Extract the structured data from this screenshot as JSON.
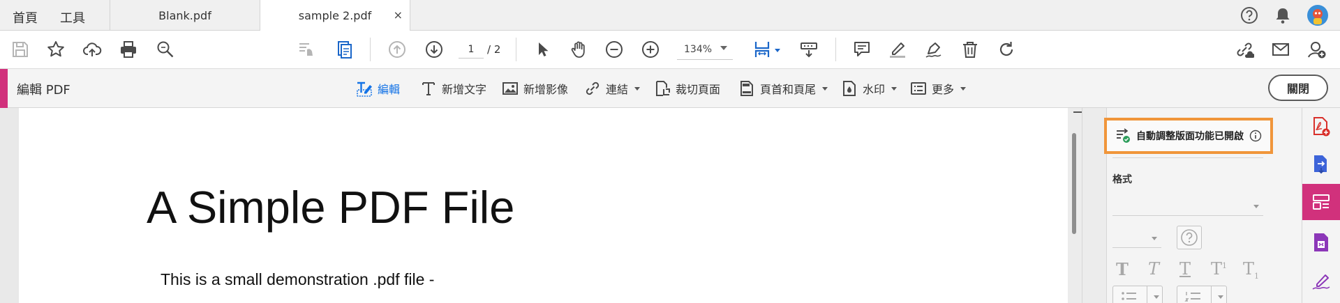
{
  "tabs": {
    "home_label": "首頁",
    "tools_label": "工具",
    "documents": [
      {
        "label": "Blank.pdf",
        "active": false
      },
      {
        "label": "sample 2.pdf",
        "active": true
      }
    ],
    "close_glyph": "×"
  },
  "header_icons": [
    "help-icon",
    "bell-icon",
    "avatar"
  ],
  "toolbar": {
    "page_current": "1",
    "page_total": "/ 2",
    "zoom": "134%",
    "icons": [
      "save-icon",
      "star-icon",
      "cloud-upload-icon",
      "print-icon",
      "zoom-search-icon",
      "read-mode-icon",
      "page-icon",
      "page-up-icon",
      "page-down-icon",
      "select-arrow-icon",
      "hand-icon",
      "zoom-out-icon",
      "zoom-in-icon",
      "fit-page-icon",
      "scroll-mode-icon",
      "comment-icon",
      "highlight-icon",
      "sign-icon",
      "delete-icon",
      "rotate-icon",
      "share-link-icon",
      "email-icon",
      "add-user-icon"
    ]
  },
  "edit_bar": {
    "title": "編輯 PDF",
    "tools": [
      {
        "label": "編輯",
        "icon": "edit-text-icon",
        "active": true,
        "dropdown": false
      },
      {
        "label": "新增文字",
        "icon": "add-text-icon",
        "active": false,
        "dropdown": false
      },
      {
        "label": "新增影像",
        "icon": "add-image-icon",
        "active": false,
        "dropdown": false
      },
      {
        "label": "連結",
        "icon": "link-icon",
        "active": false,
        "dropdown": true
      },
      {
        "label": "裁切頁面",
        "icon": "crop-page-icon",
        "active": false,
        "dropdown": false
      },
      {
        "label": "頁首和頁尾",
        "icon": "header-footer-icon",
        "active": false,
        "dropdown": true
      },
      {
        "label": "水印",
        "icon": "watermark-icon",
        "active": false,
        "dropdown": true
      },
      {
        "label": "更多",
        "icon": "more-icon",
        "active": false,
        "dropdown": true
      }
    ],
    "close_label": "關閉"
  },
  "document": {
    "title": "A Simple PDF File",
    "body": "This is a small demonstration .pdf file -"
  },
  "format_panel": {
    "reflow_notice": "自動調整版面功能已開啟",
    "format_label": "格式",
    "text_styles": [
      "T",
      "T",
      "T",
      "T",
      "T"
    ],
    "style_superscripts": [
      "",
      "",
      "",
      "1",
      "1"
    ]
  },
  "rail": {
    "items": [
      "create-pdf-icon",
      "export-pdf-icon",
      "edit-pdf-icon",
      "compress-pdf-icon",
      "fill-sign-icon"
    ],
    "active_index": 2
  },
  "colors": {
    "accent_pink": "#d1317c",
    "highlight_orange": "#f0953a",
    "active_blue": "#1473e6",
    "rail_red": "#d9302b",
    "rail_blue": "#3d64d9",
    "rail_purple": "#8c37b8"
  }
}
